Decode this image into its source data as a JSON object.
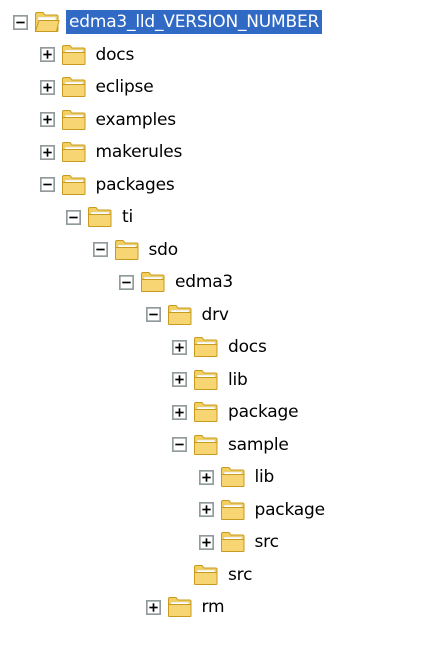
{
  "colors": {
    "selection": "#316ac5",
    "folder_fill": "#f6d572",
    "folder_edge": "#c79b1f"
  },
  "tree": [
    {
      "label": "edma3_lld_VERSION_NUMBER",
      "depth": 0,
      "state": "expanded",
      "selected": true,
      "icon": "folder-open-icon"
    },
    {
      "label": "docs",
      "depth": 1,
      "state": "collapsed",
      "selected": false,
      "icon": "folder-icon"
    },
    {
      "label": "eclipse",
      "depth": 1,
      "state": "collapsed",
      "selected": false,
      "icon": "folder-icon"
    },
    {
      "label": "examples",
      "depth": 1,
      "state": "collapsed",
      "selected": false,
      "icon": "folder-icon"
    },
    {
      "label": "makerules",
      "depth": 1,
      "state": "collapsed",
      "selected": false,
      "icon": "folder-icon"
    },
    {
      "label": "packages",
      "depth": 1,
      "state": "expanded",
      "selected": false,
      "icon": "folder-icon"
    },
    {
      "label": "ti",
      "depth": 2,
      "state": "expanded",
      "selected": false,
      "icon": "folder-icon"
    },
    {
      "label": "sdo",
      "depth": 3,
      "state": "expanded",
      "selected": false,
      "icon": "folder-icon"
    },
    {
      "label": "edma3",
      "depth": 4,
      "state": "expanded",
      "selected": false,
      "icon": "folder-icon"
    },
    {
      "label": "drv",
      "depth": 5,
      "state": "expanded",
      "selected": false,
      "icon": "folder-icon"
    },
    {
      "label": "docs",
      "depth": 6,
      "state": "collapsed",
      "selected": false,
      "icon": "folder-icon"
    },
    {
      "label": "lib",
      "depth": 6,
      "state": "collapsed",
      "selected": false,
      "icon": "folder-icon"
    },
    {
      "label": "package",
      "depth": 6,
      "state": "collapsed",
      "selected": false,
      "icon": "folder-icon"
    },
    {
      "label": "sample",
      "depth": 6,
      "state": "expanded",
      "selected": false,
      "icon": "folder-icon"
    },
    {
      "label": "lib",
      "depth": 7,
      "state": "collapsed",
      "selected": false,
      "icon": "folder-icon"
    },
    {
      "label": "package",
      "depth": 7,
      "state": "collapsed",
      "selected": false,
      "icon": "folder-icon"
    },
    {
      "label": "src",
      "depth": 7,
      "state": "collapsed",
      "selected": false,
      "icon": "folder-icon"
    },
    {
      "label": "src",
      "depth": 6,
      "state": "none",
      "selected": false,
      "icon": "folder-icon"
    },
    {
      "label": "rm",
      "depth": 5,
      "state": "collapsed",
      "selected": false,
      "icon": "folder-icon"
    }
  ]
}
